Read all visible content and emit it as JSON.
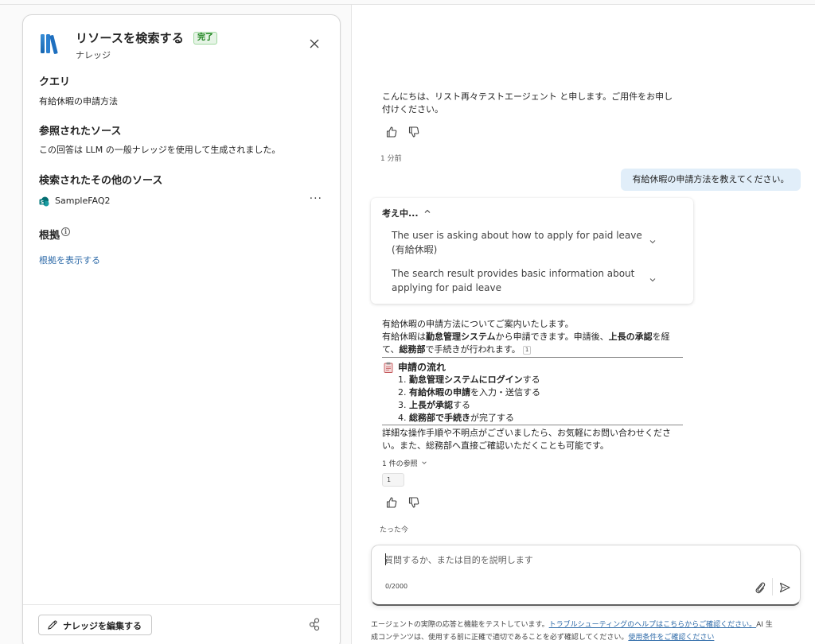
{
  "panel": {
    "title": "リソースを検索する",
    "badge": "完了",
    "subtitle": "ナレッジ",
    "query_heading": "クエリ",
    "query_text": "有給休暇の申請方法",
    "referenced_heading": "参照されたソース",
    "referenced_text": "この回答は LLM の一般ナレッジを使用して生成されました。",
    "other_sources_heading": "検索されたその他のソース",
    "source_name": "SampleFAQ2",
    "more_label": "···",
    "grounds_heading": "根拠",
    "show_grounds_link": "根拠を表示する",
    "edit_knowledge_button": "ナレッジを編集する"
  },
  "chat": {
    "greeting_line1": "こんにちは、リスト再々テストエージェント と申します。ご用件をお申し",
    "greeting_line2": "付けください。",
    "time1": "1 分前",
    "user_message": "有給休暇の申請方法を教えてください。",
    "thinking": {
      "header": "考え中...",
      "items": [
        {
          "line1": "The user is asking about how to apply for paid leave",
          "line2": "(有給休暇)"
        },
        {
          "line1": "The search result provides basic information about",
          "line2": "applying for paid leave"
        }
      ]
    },
    "answer": {
      "intro": "有給休暇の申請方法についてご案内いたします。",
      "l2_a": "有給休暇は",
      "l2_b": "勤怠管理システム",
      "l2_c": "から申請できます。申請後、",
      "l2_d": "上長の承認",
      "l2_e": "を経",
      "l3_a": "て、",
      "l3_b": "総務部",
      "l3_c": "で手続きが行われます。",
      "ref_mark": "1",
      "flow_title": "申請の流れ",
      "steps": [
        {
          "num": "1.",
          "bold": "勤怠管理システムにログイン",
          "rest": "する"
        },
        {
          "num": "2.",
          "bold": "有給休暇の申請",
          "rest": "を入力・送信する"
        },
        {
          "num": "3.",
          "bold": "上長が承認",
          "rest": "する"
        },
        {
          "num": "4.",
          "bold": "総務部で手続き",
          "rest": "が完了する"
        }
      ],
      "closing1": "詳細な操作手順や不明点がございましたら、お気軽にお問い合わせくださ",
      "closing2": "い。また、総務部へ直接ご確認いただくことも可能です。",
      "refs_toggle": "1 件の参照",
      "ref_chip": "1"
    },
    "time2": "たった今"
  },
  "input": {
    "placeholder": "質問するか、または目的を説明します",
    "counter": "0/2000"
  },
  "disclaimer": {
    "text1": "エージェントの実際の応答と機能をテストしています。",
    "link1": "トラブルシューティングのヘルプはこちらからご確認ください。",
    "text2_a": "AI 生",
    "text2_b": "成コンテンツは、使用する前に正確で適切であることを必ず確認してください。",
    "link2": "使用条件をご確認ください"
  }
}
